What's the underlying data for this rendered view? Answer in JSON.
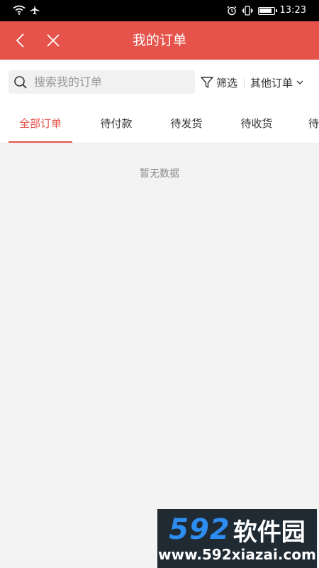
{
  "status_bar": {
    "time": "13:23",
    "icons": [
      "wifi-icon",
      "airplane-icon",
      "alarm-icon",
      "vibrate-icon",
      "battery-icon"
    ]
  },
  "header": {
    "title": "我的订单",
    "background": "#e5534b",
    "back_icon": "chevron-left-icon",
    "close_icon": "close-icon"
  },
  "search": {
    "placeholder": "搜索我的订单",
    "value": "",
    "filter_label": "筛选",
    "other_orders_label": "其他订单"
  },
  "tabs": [
    {
      "label": "全部订单",
      "active": true
    },
    {
      "label": "待付款",
      "active": false
    },
    {
      "label": "待发货",
      "active": false
    },
    {
      "label": "待收货",
      "active": false
    },
    {
      "label": "待",
      "active": false
    }
  ],
  "empty_state": {
    "text": "暂无数据"
  },
  "watermark": {
    "brand_number": "592",
    "brand_text": "软件园",
    "url": "www.592xiazai.com"
  },
  "colors": {
    "accent": "#e5534b",
    "page_bg": "#f3f3f3"
  }
}
